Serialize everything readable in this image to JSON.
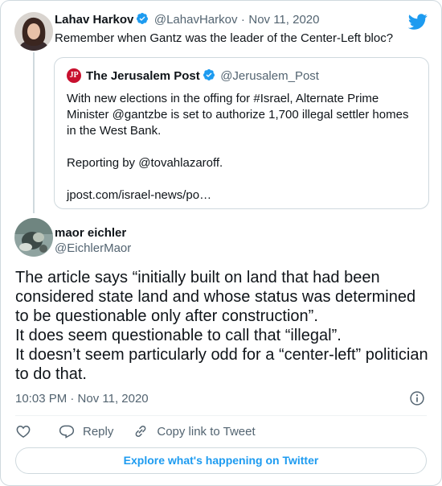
{
  "parent_tweet": {
    "name": "Lahav Harkov",
    "handle": "@LahavHarkov",
    "separator": "·",
    "date": "Nov 11, 2020",
    "text": "Remember when Gantz was the leader of the Center-Left bloc?"
  },
  "quoted_tweet": {
    "name": "The Jerusalem Post",
    "handle": "@Jerusalem_Post",
    "logo_text": "JP",
    "paragraphs": [
      "With new elections in the offing for #Israel, Alternate Prime Minister @gantzbe is set to authorize 1,700 illegal settler homes in the West Bank.",
      "Reporting by @tovahlazaroff.",
      "jpost.com/israel-news/po…"
    ]
  },
  "main_tweet": {
    "name": "maor eichler",
    "handle": "@EichlerMaor",
    "lines": [
      "The article says “initially built on land that had been considered state land and whose status was determined to be questionable only after construction”.",
      "It does seem questionable to call that “illegal”.",
      "It doesn’t seem particularly odd for a “center-left” politician to do that."
    ],
    "timestamp": "10:03 PM · Nov 11, 2020"
  },
  "actions": {
    "reply_label": "Reply",
    "copy_link_label": "Copy link to Tweet"
  },
  "explore_label": "Explore what's happening on Twitter",
  "colors": {
    "accent": "#1d9bf0",
    "secondary_text": "#536471",
    "border": "#cfd9de"
  },
  "icons": [
    "twitter-bird-icon",
    "verified-badge-icon",
    "info-icon",
    "heart-icon",
    "reply-icon",
    "link-icon"
  ]
}
